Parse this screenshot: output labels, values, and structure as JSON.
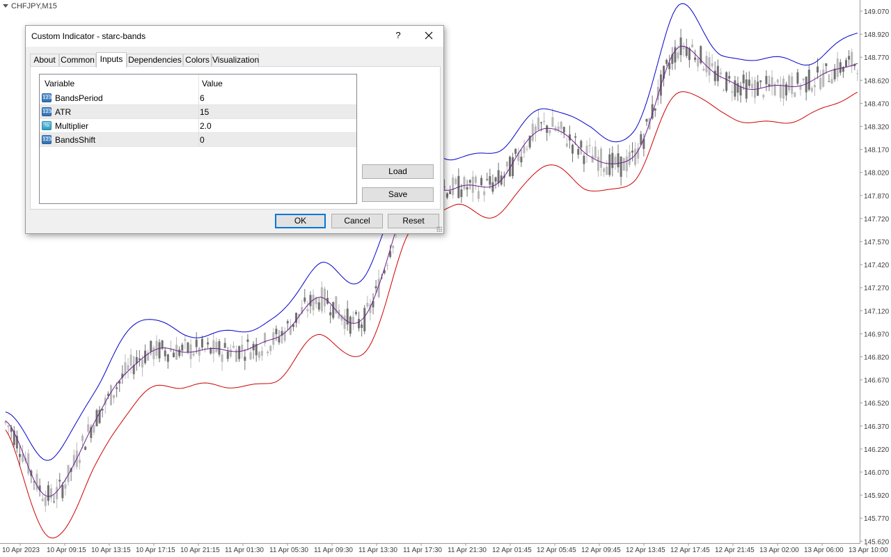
{
  "chart": {
    "symbol": "CHFJPY,M15",
    "price_labels": [
      "149.070",
      "148.920",
      "148.770",
      "148.620",
      "148.470",
      "148.320",
      "148.170",
      "148.020",
      "147.870",
      "147.720",
      "147.570",
      "147.420",
      "147.270",
      "147.120",
      "146.970",
      "146.820",
      "146.670",
      "146.520",
      "146.370",
      "146.220",
      "146.070",
      "145.920",
      "145.770",
      "145.620"
    ],
    "time_labels": [
      "10 Apr 2023",
      "10 Apr 09:15",
      "10 Apr 13:15",
      "10 Apr 17:15",
      "10 Apr 21:15",
      "11 Apr 01:30",
      "11 Apr 05:30",
      "11 Apr 09:30",
      "11 Apr 13:30",
      "11 Apr 17:30",
      "11 Apr 21:30",
      "12 Apr 01:45",
      "12 Apr 05:45",
      "12 Apr 09:45",
      "12 Apr 13:45",
      "12 Apr 17:45",
      "12 Apr 21:45",
      "13 Apr 02:00",
      "13 Apr 06:00",
      "13 Apr 10:00"
    ],
    "colors": {
      "upper_band": "#0000cc",
      "middle_line": "#6a1e8c",
      "lower_band": "#cc0000",
      "candles": "#808080",
      "axis_text": "#3c3c3c",
      "grid_border": "#a0a0a0"
    }
  },
  "chart_data": {
    "type": "line",
    "x": [
      "10 Apr 2023",
      "10 Apr 09:15",
      "10 Apr 13:15",
      "10 Apr 17:15",
      "10 Apr 21:15",
      "11 Apr 01:30",
      "11 Apr 05:30",
      "11 Apr 09:30",
      "11 Apr 13:30",
      "11 Apr 17:30",
      "11 Apr 21:30",
      "12 Apr 01:45",
      "12 Apr 05:45",
      "12 Apr 09:45",
      "12 Apr 13:45",
      "12 Apr 17:45",
      "12 Apr 21:45",
      "13 Apr 02:00",
      "13 Apr 06:00",
      "13 Apr 10:00"
    ],
    "series": [
      {
        "values": [
          146.45,
          146.15,
          146.6,
          147.05,
          146.95,
          146.97,
          147.05,
          147.4,
          147.32,
          148.05,
          148.1,
          148.15,
          148.42,
          148.3,
          148.25,
          149.07,
          148.75,
          148.75,
          148.72,
          148.92
        ]
      },
      {
        "values": [
          146.38,
          145.9,
          146.4,
          146.8,
          146.85,
          146.85,
          146.92,
          147.18,
          147.05,
          147.85,
          147.9,
          147.95,
          148.3,
          148.12,
          148.1,
          148.8,
          148.6,
          148.55,
          148.6,
          148.72
        ]
      },
      {
        "values": [
          146.32,
          145.62,
          146.1,
          146.55,
          146.62,
          146.62,
          146.65,
          146.95,
          146.82,
          147.6,
          147.78,
          147.73,
          148.05,
          147.9,
          147.95,
          148.52,
          148.38,
          148.32,
          148.38,
          148.52
        ]
      }
    ],
    "ylim": [
      145.6,
      149.12
    ]
  },
  "dialog": {
    "title": "Custom Indicator - starc-bands",
    "help_label": "?",
    "close_label": "✕",
    "tabs": [
      "About",
      "Common",
      "Inputs",
      "Dependencies",
      "Colors",
      "Visualization"
    ],
    "active_tab": "Inputs",
    "columns": {
      "variable": "Variable",
      "value": "Value"
    },
    "params": [
      {
        "icon": "123",
        "name": "BandsPeriod",
        "value": "6"
      },
      {
        "icon": "123",
        "name": "ATR",
        "value": "15"
      },
      {
        "icon": "½",
        "name": "Multiplier",
        "value": "2.0"
      },
      {
        "icon": "123",
        "name": "BandsShift",
        "value": "0"
      }
    ],
    "buttons": {
      "load": "Load",
      "save": "Save",
      "ok": "OK",
      "cancel": "Cancel",
      "reset": "Reset"
    }
  }
}
